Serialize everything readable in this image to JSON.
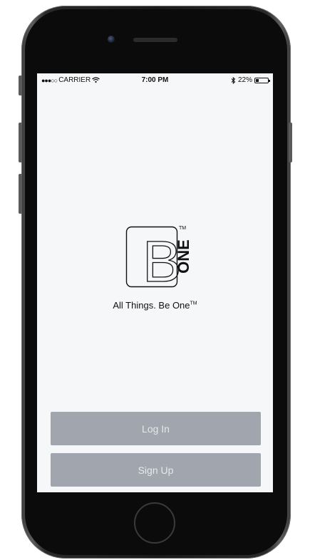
{
  "status_bar": {
    "signal_dots": "●●●○○",
    "carrier": "CARRIER",
    "wifi_icon": "wifi-icon",
    "time": "7:00 PM",
    "bluetooth_icon": "bluetooth-icon",
    "battery_text": "22%",
    "battery_level": 0.22
  },
  "brand": {
    "logo_letter": "B",
    "logo_word": "ONE",
    "logo_tm": "TM",
    "tagline": "All Things. Be One",
    "tagline_tm": "TM"
  },
  "buttons": {
    "login_label": "Log In",
    "signup_label": "Sign Up"
  },
  "colors": {
    "screen_background": "#f6f7f9",
    "button_background": "#a1a5ad",
    "button_text": "#e6e8ec",
    "phone_body": "#1a1a1a"
  }
}
